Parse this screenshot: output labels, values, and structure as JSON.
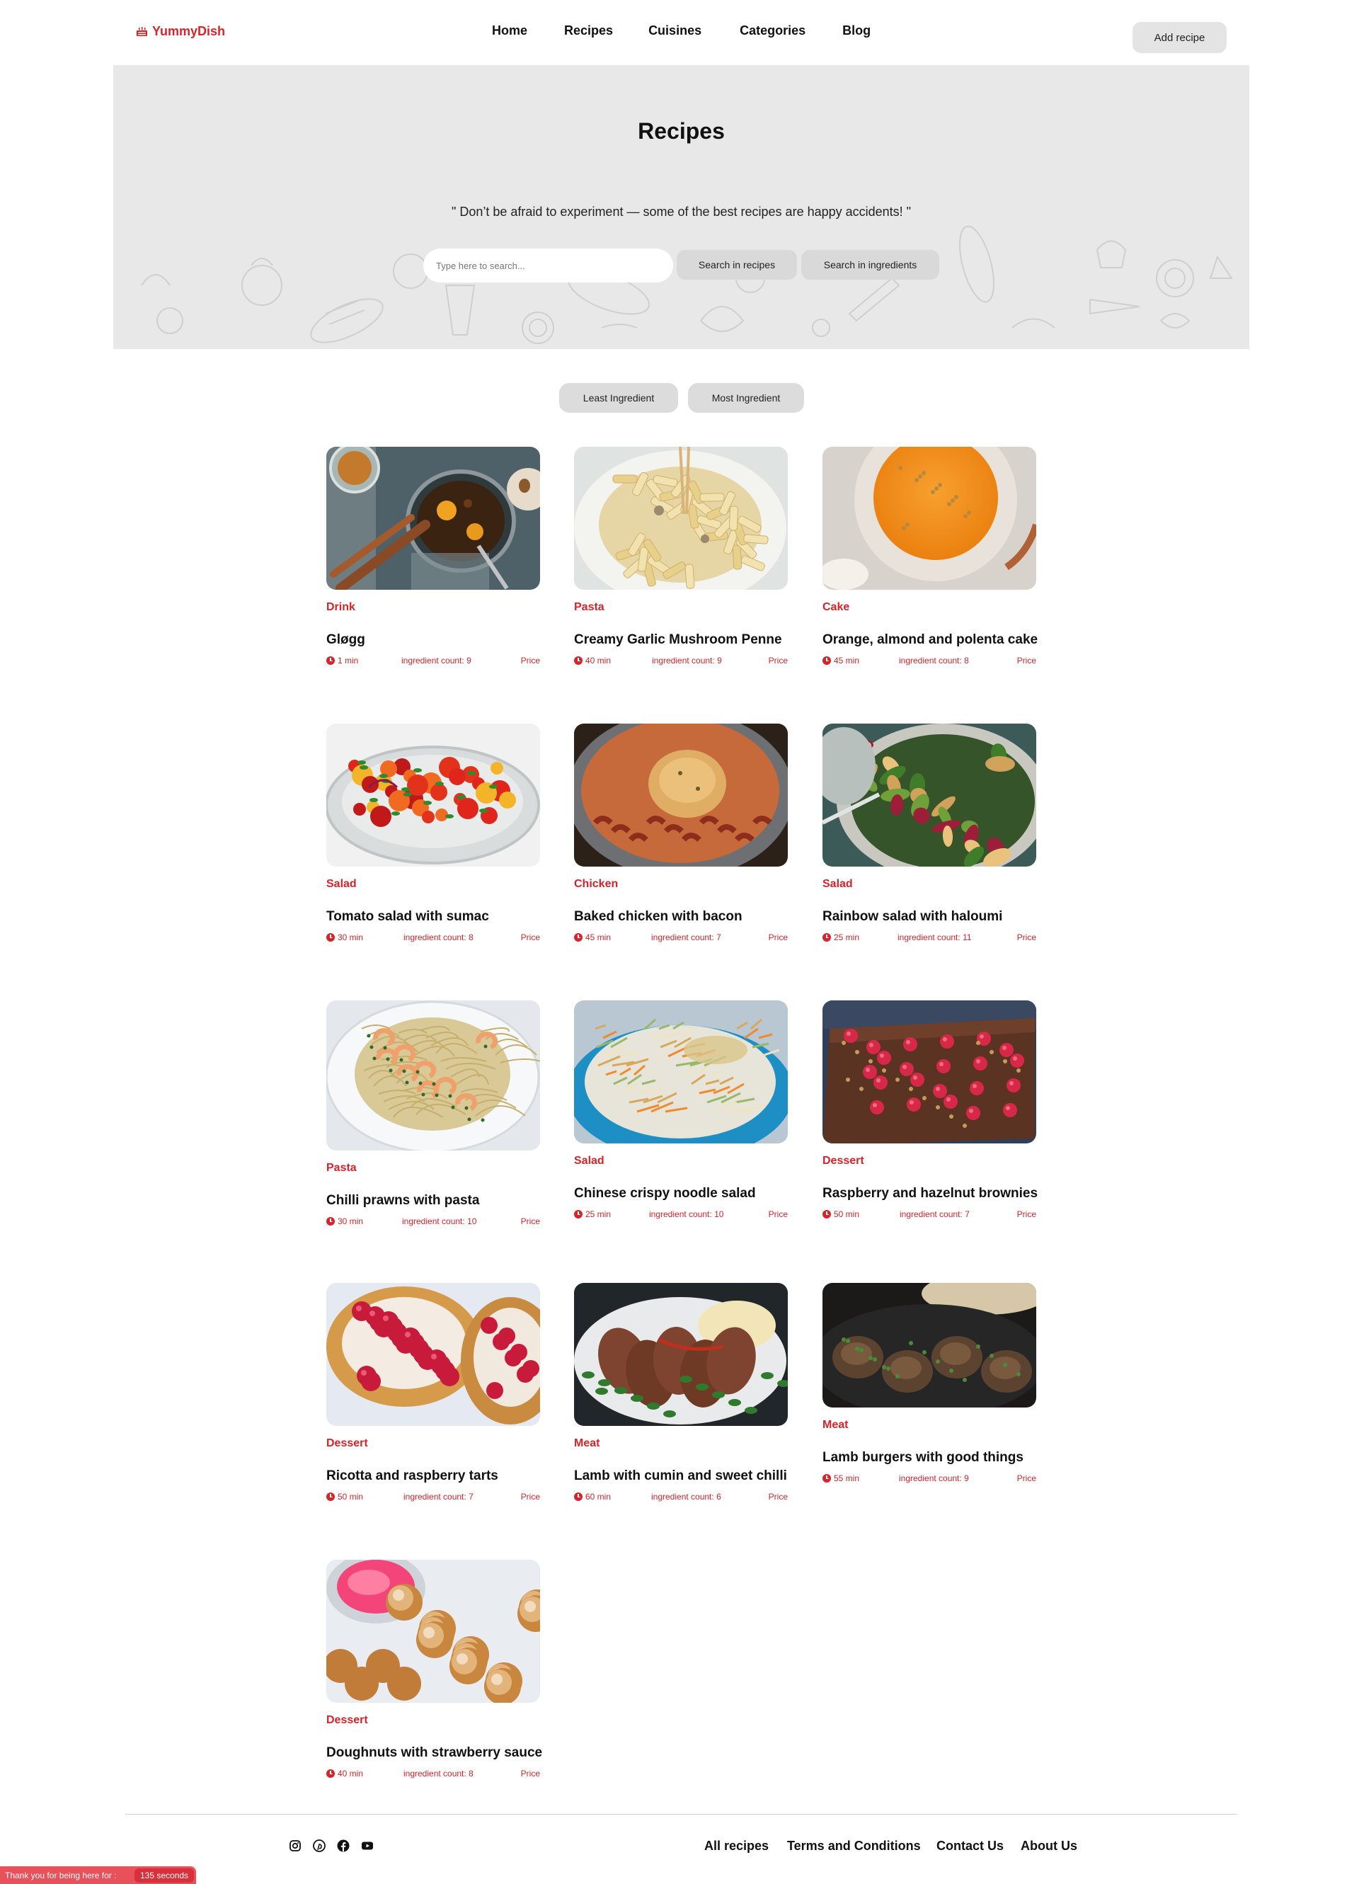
{
  "brand": {
    "name": "YummyDish",
    "accent": "#d8232a"
  },
  "nav": {
    "links": [
      "Home",
      "Recipes",
      "Cuisines",
      "Categories",
      "Blog"
    ],
    "add_recipe": "Add recipe"
  },
  "hero": {
    "title": "Recipes",
    "quote": "\" Don’t be afraid to experiment — some of the best recipes are happy accidents! \"",
    "search_placeholder": "Type here to search...",
    "search_recipes": "Search in recipes",
    "search_ingredients": "Search in ingredients"
  },
  "sort": {
    "least": "Least Ingredient",
    "most": "Most Ingredient"
  },
  "recipes": [
    {
      "category": "Drink",
      "title": "Gløgg",
      "time": "1 min",
      "ingredients": "ingredient count: 9",
      "price": "Price",
      "image": "mulled-wine"
    },
    {
      "category": "Pasta",
      "title": "Creamy Garlic Mushroom Penne",
      "time": "40 min",
      "ingredients": "ingredient count: 9",
      "price": "Price",
      "image": "penne"
    },
    {
      "category": "Cake",
      "title": "Orange, almond and polenta cake",
      "time": "45 min",
      "ingredients": "ingredient count: 8",
      "price": "Price",
      "image": "orange-cake"
    },
    {
      "category": "Salad",
      "title": "Tomato salad with sumac",
      "time": "30 min",
      "ingredients": "ingredient count: 8",
      "price": "Price",
      "image": "tomato-salad"
    },
    {
      "category": "Chicken",
      "title": "Baked chicken with bacon",
      "time": "45 min",
      "ingredients": "ingredient count: 7",
      "price": "Price",
      "image": "baked-chicken"
    },
    {
      "category": "Salad",
      "title": "Rainbow salad with haloumi",
      "time": "25 min",
      "ingredients": "ingredient count: 11",
      "price": "Price",
      "image": "rainbow-salad"
    },
    {
      "category": "Pasta",
      "title": "Chilli prawns with pasta",
      "time": "30 min",
      "ingredients": "ingredient count: 10",
      "price": "Price",
      "image": "prawn-pasta"
    },
    {
      "category": "Salad",
      "title": "Chinese crispy noodle salad",
      "time": "25 min",
      "ingredients": "ingredient count: 10",
      "price": "Price",
      "image": "noodle-salad"
    },
    {
      "category": "Dessert",
      "title": "Raspberry and hazelnut brownies",
      "time": "50 min",
      "ingredients": "ingredient count: 7",
      "price": "Price",
      "image": "brownies"
    },
    {
      "category": "Dessert",
      "title": "Ricotta and raspberry tarts",
      "time": "50 min",
      "ingredients": "ingredient count: 7",
      "price": "Price",
      "image": "raspberry-tarts"
    },
    {
      "category": "Meat",
      "title": "Lamb with cumin and sweet chilli",
      "time": "60 min",
      "ingredients": "ingredient count: 6",
      "price": "Price",
      "image": "lamb-chops"
    },
    {
      "category": "Meat",
      "title": "Lamb burgers with good things",
      "time": "55 min",
      "ingredients": "ingredient count: 9",
      "price": "Price",
      "image": "lamb-burgers"
    },
    {
      "category": "Dessert",
      "title": "Doughnuts with strawberry sauce",
      "time": "40 min",
      "ingredients": "ingredient count: 8",
      "price": "Price",
      "image": "doughnuts"
    }
  ],
  "footer": {
    "social": [
      "instagram-icon",
      "pinterest-icon",
      "facebook-icon",
      "youtube-icon"
    ],
    "links": [
      "All recipes",
      "Terms and Conditions",
      "Contact Us",
      "About Us"
    ]
  },
  "toast": {
    "label": "Thank you for being here for :",
    "value": "135 seconds"
  }
}
